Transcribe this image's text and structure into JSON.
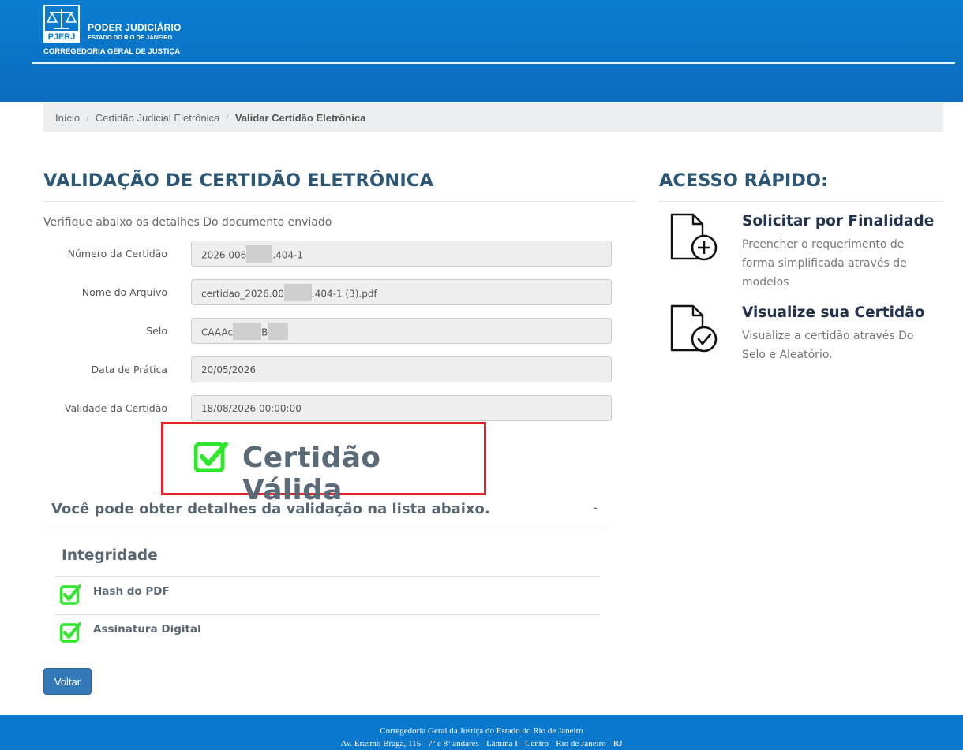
{
  "header": {
    "logo_text": "PJERJ",
    "org_name": "PODER JUDICIÁRIO",
    "org_state": "ESTADO DO RIO DE JANEIRO",
    "org_dept": "CORREGEDORIA GERAL DE JUSTIÇA"
  },
  "breadcrumb": {
    "home": "Início",
    "level2": "Certidão Judicial Eletrônica",
    "current": "Validar Certidão Eletrônica"
  },
  "main": {
    "title": "VALIDAÇÃO DE CERTIDÃO ELETRÔNICA",
    "intro": "Verifique abaixo os detalhes Do documento enviado",
    "fields": {
      "numero": {
        "label": "Número da Certidão",
        "prefix": "2026.006",
        "suffix": ".404-1"
      },
      "arquivo": {
        "label": "Nome do Arquivo",
        "prefix": "certidao_2026.00",
        "suffix": ".404-1 (3).pdf"
      },
      "selo": {
        "label": "Selo",
        "prefix": "CAAAc",
        "middle": "B"
      },
      "data_pratica": {
        "label": "Data de Prática",
        "value": "20/05/2026"
      },
      "validade": {
        "label": "Validade da Certidão",
        "value": "18/08/2026 00:00:00"
      }
    },
    "status": {
      "text": "Certidão Válida",
      "color": "#2ee62a"
    },
    "details": {
      "title": "Você pode obter detalhes da validação na lista abaixo.",
      "toggle": "-",
      "section_title": "Integridade",
      "items": [
        {
          "label": "Hash do PDF"
        },
        {
          "label": "Assinatura Digital"
        }
      ]
    },
    "back_button": "Voltar"
  },
  "sidebar": {
    "title": "ACESSO RÁPIDO:",
    "links": [
      {
        "title": "Solicitar por Finalidade",
        "desc": "Preencher o requerimento de forma simplificada através de modelos",
        "icon": "document-add-icon"
      },
      {
        "title": "Visualize sua Certidão",
        "desc": "Visualize a certidão através Do Selo e Aleatório.",
        "icon": "document-check-icon"
      }
    ]
  },
  "footer": {
    "line1": "Corregedoria Geral da Justiça do Estado do Rio de Janeiro",
    "line2": "Av. Erasmo Braga, 115 - 7º e 8º andares - Lâmina I - Centro - Rio de Janeiro - RJ"
  },
  "colors": {
    "header_blue": "#0b7dd0",
    "title_blue": "#2b5676",
    "highlight_red": "#e0242a",
    "check_green": "#2ee62a",
    "button_blue": "#3379b7"
  }
}
